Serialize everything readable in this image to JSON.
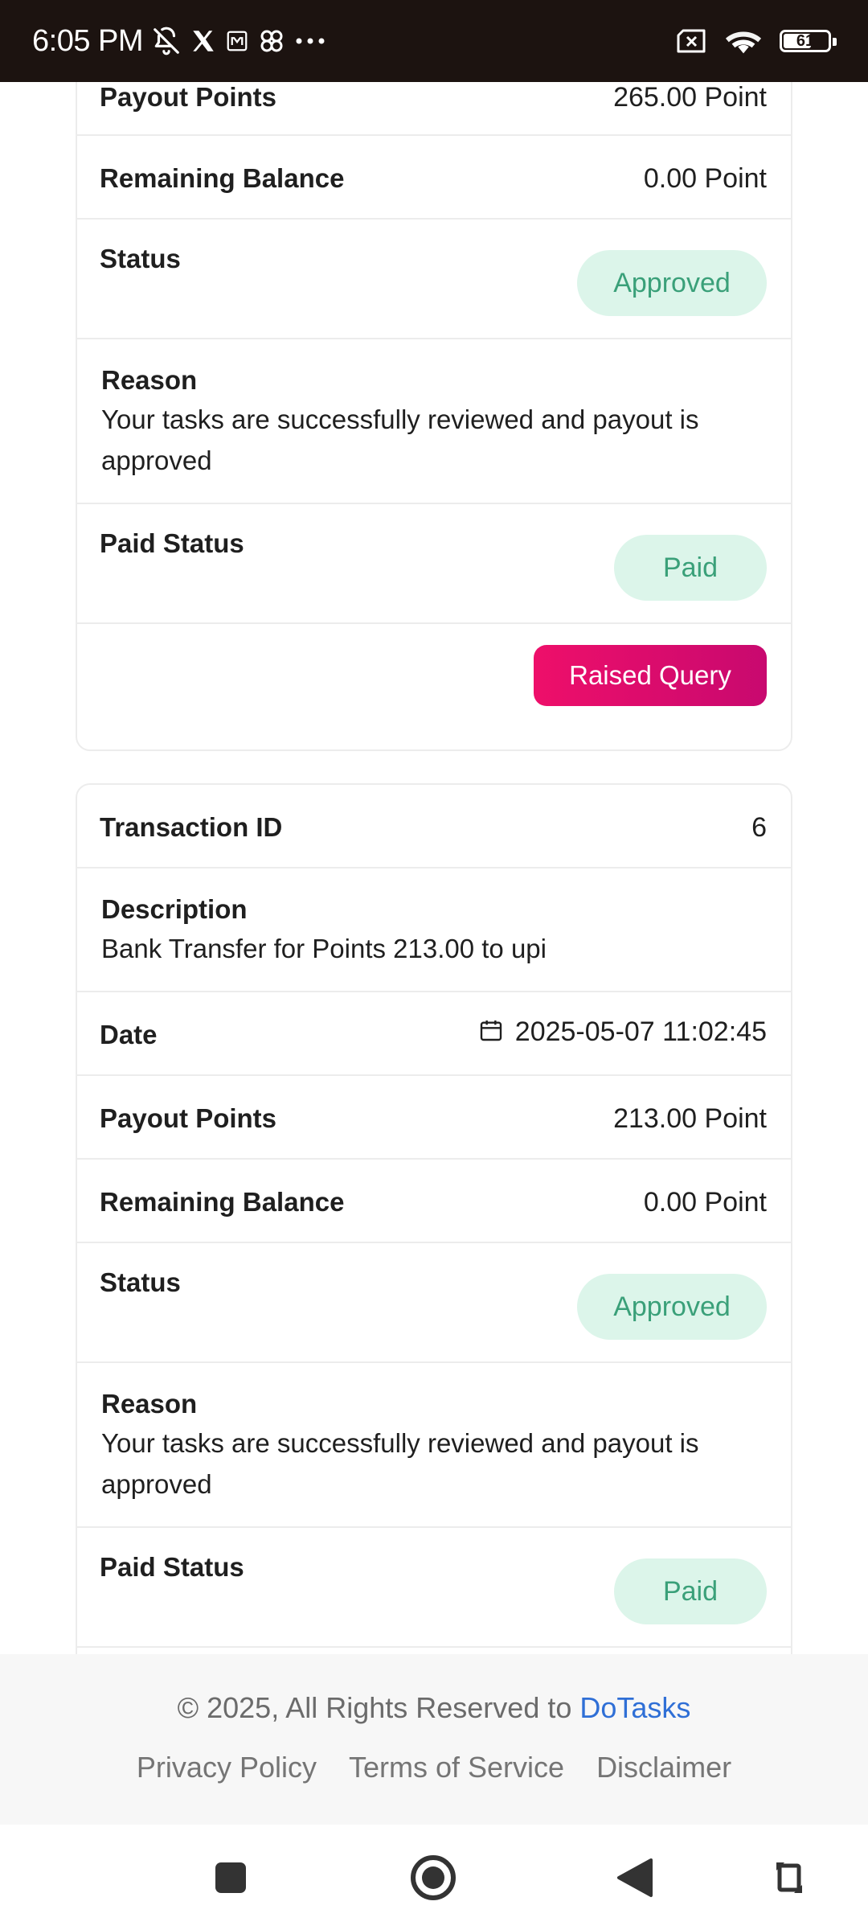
{
  "status_bar": {
    "time": "6:05 PM",
    "battery": "61",
    "icons": [
      "bell-off-icon",
      "x-logo-icon",
      "m-icon",
      "pinwheel-icon",
      "more-icon",
      "sim-x-icon",
      "wifi-icon",
      "battery-icon"
    ]
  },
  "cards": [
    {
      "payout_label": "Payout Points",
      "payout_value": "265.00 Point",
      "balance_label": "Remaining Balance",
      "balance_value": "0.00 Point",
      "status_label": "Status",
      "status_value": "Approved",
      "reason_label": "Reason",
      "reason_text": "Your tasks are successfully reviewed and payout is approved",
      "paid_label": "Paid Status",
      "paid_value": "Paid",
      "query_button": "Raised Query"
    },
    {
      "txn_label": "Transaction ID",
      "txn_value": "6",
      "desc_label": "Description",
      "desc_text": "Bank Transfer for Points 213.00 to upi",
      "date_label": "Date",
      "date_value": "2025-05-07 11:02:45",
      "payout_label": "Payout Points",
      "payout_value": "213.00 Point",
      "balance_label": "Remaining Balance",
      "balance_value": "0.00 Point",
      "status_label": "Status",
      "status_value": "Approved",
      "reason_label": "Reason",
      "reason_text": "Your tasks are successfully reviewed and payout is approved",
      "paid_label": "Paid Status",
      "paid_value": "Paid"
    }
  ],
  "footer": {
    "copyright": "© 2025, All Rights Reserved to ",
    "brand": "DoTasks",
    "links": [
      "Privacy Policy",
      "Terms of Service",
      "Disclaimer"
    ]
  },
  "colors": {
    "status_bar_bg": "#1c1310",
    "pill_bg": "#dcf5ea",
    "pill_text": "#3aa079",
    "button_bg": "#ee0f6a",
    "link": "#2f6fd6"
  },
  "nav_bar": {
    "buttons": [
      "recents-square-icon",
      "home-circle-icon",
      "back-triangle-icon",
      "rotate-icon"
    ]
  }
}
